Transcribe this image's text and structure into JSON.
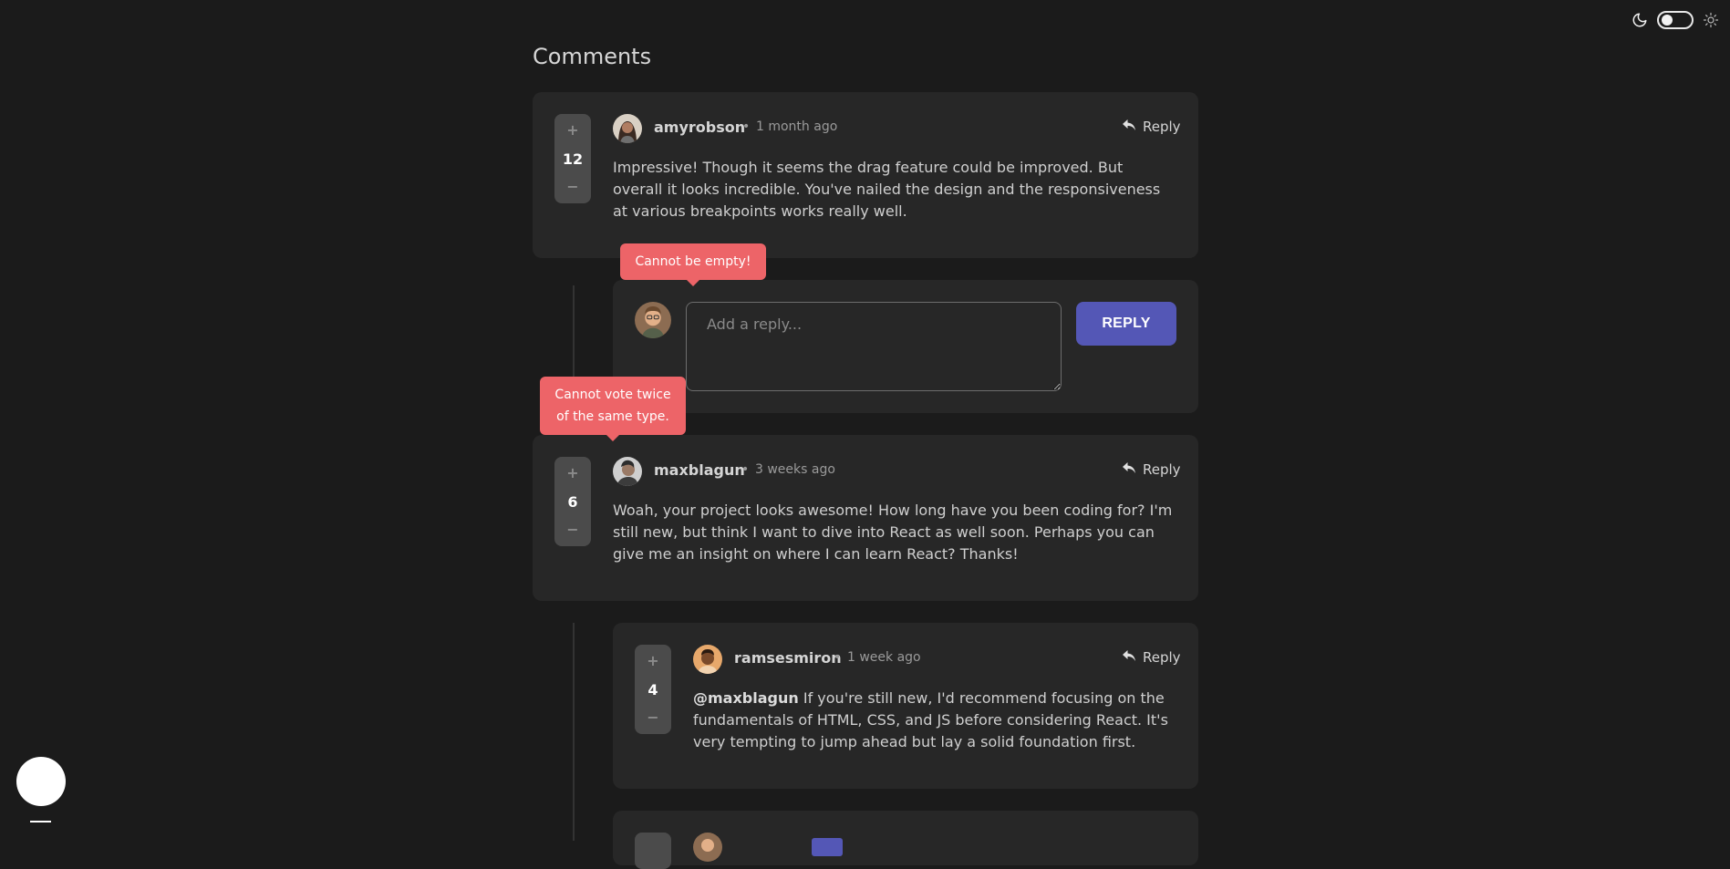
{
  "page_title": "Comments",
  "colors": {
    "background": "#1b1b1b",
    "card": "#272727",
    "accent": "#5457b6",
    "error": "#ed6468"
  },
  "comments": [
    {
      "author": "amyrobson",
      "time": "1 month ago",
      "score": "12",
      "reply_label": "Reply",
      "text": "Impressive! Though it seems the drag feature could be improved. But overall it looks incredible. You've nailed the design and the responsiveness at various breakpoints works really well."
    },
    {
      "author": "maxblagun",
      "time": "3 weeks ago",
      "score": "6",
      "reply_label": "Reply",
      "text": "Woah, your project looks awesome! How long have you been coding for? I'm still new, but think I want to dive into React as well soon. Perhaps you can give me an insight on where I can learn React? Thanks!"
    }
  ],
  "replies": [
    {
      "author": "ramsesmiron",
      "time": "1 week ago",
      "score": "4",
      "reply_label": "Reply",
      "mention": "@maxblagun",
      "text": " If you're still new, I'd recommend focusing on the fundamentals of HTML, CSS, and JS before considering React. It's very tempting to jump ahead but lay a solid foundation first."
    }
  ],
  "reply_form": {
    "placeholder": "Add a reply...",
    "button_label": "REPLY"
  },
  "tooltips": {
    "empty": "Cannot be empty!",
    "vote": "Cannot vote twice of the same type."
  },
  "vote_symbols": {
    "plus": "+",
    "minus": "−"
  },
  "separator": "•"
}
